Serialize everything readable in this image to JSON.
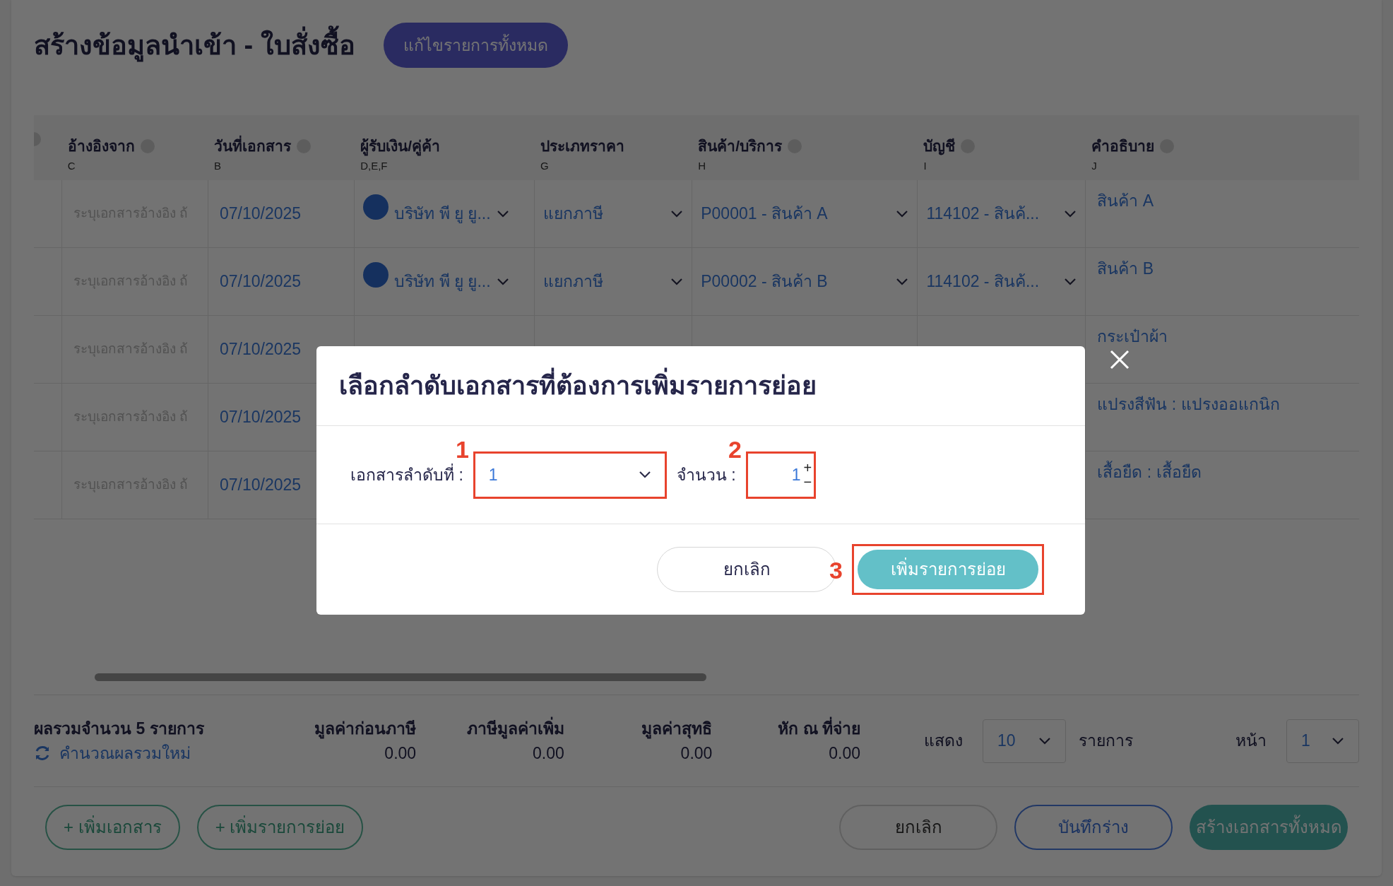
{
  "page": {
    "title": "สร้างข้อมูลนำเข้า - ใบสั่งซื้อ",
    "edit_all_button": "แก้ไขรายการทั้งหมด"
  },
  "table": {
    "columns": [
      {
        "label": "อ้างอิงจาก",
        "code": "C",
        "help": true
      },
      {
        "label": "วันที่เอกสาร",
        "code": "B",
        "help": true
      },
      {
        "label": "ผู้รับเงิน/คู่ค้า",
        "code": "D,E,F",
        "help": false
      },
      {
        "label": "ประเภทราคา",
        "code": "G",
        "help": false
      },
      {
        "label": "สินค้า/บริการ",
        "code": "H",
        "help": true
      },
      {
        "label": "บัญชี",
        "code": "I",
        "help": true
      },
      {
        "label": "คำอธิบาย",
        "code": "J",
        "help": true
      }
    ],
    "rows": [
      {
        "reference_placeholder": "ระบุเอกสารอ้างอิง ถ้",
        "date": "07/10/2025",
        "partner": "บริษัท พี ยู ยู...",
        "price_type": "แยกภาษี",
        "product": "P00001 - สินค้า A",
        "account": "114102 - สินค้...",
        "description": "สินค้า A"
      },
      {
        "reference_placeholder": "ระบุเอกสารอ้างอิง ถ้",
        "date": "07/10/2025",
        "partner": "บริษัท พี ยู ยู...",
        "price_type": "แยกภาษี",
        "product": "P00002 - สินค้า B",
        "account": "114102 - สินค้...",
        "description": "สินค้า B"
      },
      {
        "reference_placeholder": "ระบุเอกสารอ้างอิง ถ้",
        "date": "07/10/2025",
        "description": "กระเป๋าผ้า"
      },
      {
        "reference_placeholder": "ระบุเอกสารอ้างอิง ถ้",
        "date": "07/10/2025",
        "description": "แปรงสีฟัน : แปรงออแกนิก"
      },
      {
        "reference_placeholder": "ระบุเอกสารอ้างอิง ถ้",
        "date": "07/10/2025",
        "description": "เสื้อยืด : เสื้อยืด"
      }
    ]
  },
  "summary": {
    "count_label": "ผลรวมจำนวน 5 รายการ",
    "recalculate_link": "คำนวณผลรวมใหม่",
    "totals": [
      {
        "label": "มูลค่าก่อนภาษี",
        "value": "0.00"
      },
      {
        "label": "ภาษีมูลค่าเพิ่ม",
        "value": "0.00"
      },
      {
        "label": "มูลค่าสุทธิ",
        "value": "0.00"
      },
      {
        "label": "หัก ณ ที่จ่าย",
        "value": "0.00"
      }
    ]
  },
  "pagination": {
    "show_label": "แสดง",
    "page_size": "10",
    "items_label": "รายการ",
    "page_label": "หน้า",
    "page": "1"
  },
  "actions": {
    "left": [
      {
        "label": "+ เพิ่มเอกสาร",
        "kind": "outline-green"
      },
      {
        "label": "+ เพิ่มรายการย่อย",
        "kind": "outline-green"
      }
    ],
    "right": [
      {
        "label": "ยกเลิก",
        "kind": "outline-grey"
      },
      {
        "label": "บันทึกร่าง",
        "kind": "outline-blue"
      },
      {
        "label": "สร้างเอกสารทั้งหมด",
        "kind": "filled-teal"
      }
    ]
  },
  "modal": {
    "title": "เลือกลำดับเอกสารที่ต้องการเพิ่มรายการย่อย",
    "document_label": "เอกสารลำดับที่ :",
    "document_value": "1",
    "quantity_label": "จำนวน :",
    "quantity_value": "1",
    "increment": "+",
    "decrement": "−",
    "cancel_button": "ยกเลิก",
    "confirm_button": "เพิ่มรายการย่อย"
  },
  "annotations": [
    {
      "label": "1"
    },
    {
      "label": "2"
    },
    {
      "label": "3"
    }
  ]
}
